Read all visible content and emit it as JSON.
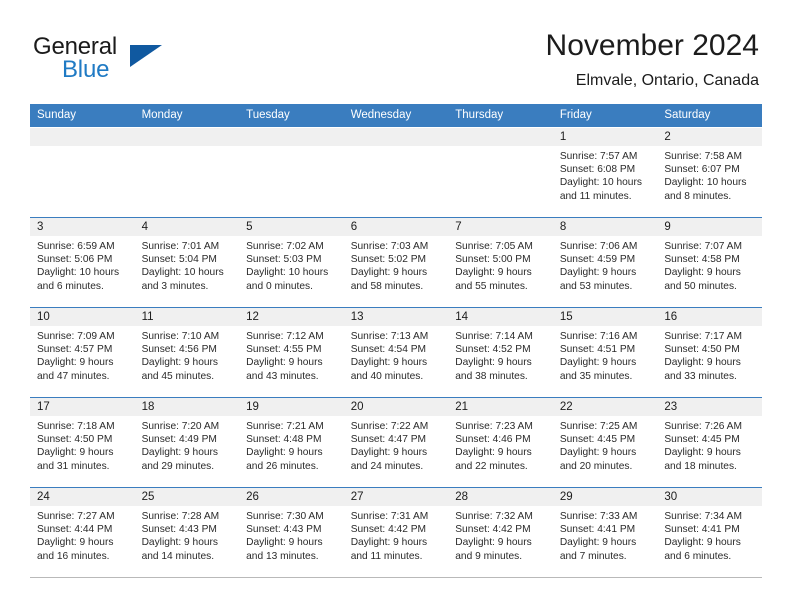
{
  "brand": {
    "name_part1": "General",
    "name_part2": "Blue",
    "triangle_color": "#1059a0",
    "blue_color": "#1f7ac4"
  },
  "header": {
    "title": "November 2024",
    "subtitle": "Elmvale, Ontario, Canada"
  },
  "theme": {
    "header_row_bg": "#3a7dbf",
    "daynum_band_bg": "#f0f0f0",
    "cell_bg": "#ffffff",
    "row_border": "#3a7dbf"
  },
  "weekday_headers": [
    "Sunday",
    "Monday",
    "Tuesday",
    "Wednesday",
    "Thursday",
    "Friday",
    "Saturday"
  ],
  "weeks": [
    [
      {
        "day": "",
        "sunrise": "",
        "sunset": "",
        "daylight_line1": "",
        "daylight_line2": ""
      },
      {
        "day": "",
        "sunrise": "",
        "sunset": "",
        "daylight_line1": "",
        "daylight_line2": ""
      },
      {
        "day": "",
        "sunrise": "",
        "sunset": "",
        "daylight_line1": "",
        "daylight_line2": ""
      },
      {
        "day": "",
        "sunrise": "",
        "sunset": "",
        "daylight_line1": "",
        "daylight_line2": ""
      },
      {
        "day": "",
        "sunrise": "",
        "sunset": "",
        "daylight_line1": "",
        "daylight_line2": ""
      },
      {
        "day": "1",
        "sunrise": "Sunrise: 7:57 AM",
        "sunset": "Sunset: 6:08 PM",
        "daylight_line1": "Daylight: 10 hours",
        "daylight_line2": "and 11 minutes."
      },
      {
        "day": "2",
        "sunrise": "Sunrise: 7:58 AM",
        "sunset": "Sunset: 6:07 PM",
        "daylight_line1": "Daylight: 10 hours",
        "daylight_line2": "and 8 minutes."
      }
    ],
    [
      {
        "day": "3",
        "sunrise": "Sunrise: 6:59 AM",
        "sunset": "Sunset: 5:06 PM",
        "daylight_line1": "Daylight: 10 hours",
        "daylight_line2": "and 6 minutes."
      },
      {
        "day": "4",
        "sunrise": "Sunrise: 7:01 AM",
        "sunset": "Sunset: 5:04 PM",
        "daylight_line1": "Daylight: 10 hours",
        "daylight_line2": "and 3 minutes."
      },
      {
        "day": "5",
        "sunrise": "Sunrise: 7:02 AM",
        "sunset": "Sunset: 5:03 PM",
        "daylight_line1": "Daylight: 10 hours",
        "daylight_line2": "and 0 minutes."
      },
      {
        "day": "6",
        "sunrise": "Sunrise: 7:03 AM",
        "sunset": "Sunset: 5:02 PM",
        "daylight_line1": "Daylight: 9 hours",
        "daylight_line2": "and 58 minutes."
      },
      {
        "day": "7",
        "sunrise": "Sunrise: 7:05 AM",
        "sunset": "Sunset: 5:00 PM",
        "daylight_line1": "Daylight: 9 hours",
        "daylight_line2": "and 55 minutes."
      },
      {
        "day": "8",
        "sunrise": "Sunrise: 7:06 AM",
        "sunset": "Sunset: 4:59 PM",
        "daylight_line1": "Daylight: 9 hours",
        "daylight_line2": "and 53 minutes."
      },
      {
        "day": "9",
        "sunrise": "Sunrise: 7:07 AM",
        "sunset": "Sunset: 4:58 PM",
        "daylight_line1": "Daylight: 9 hours",
        "daylight_line2": "and 50 minutes."
      }
    ],
    [
      {
        "day": "10",
        "sunrise": "Sunrise: 7:09 AM",
        "sunset": "Sunset: 4:57 PM",
        "daylight_line1": "Daylight: 9 hours",
        "daylight_line2": "and 47 minutes."
      },
      {
        "day": "11",
        "sunrise": "Sunrise: 7:10 AM",
        "sunset": "Sunset: 4:56 PM",
        "daylight_line1": "Daylight: 9 hours",
        "daylight_line2": "and 45 minutes."
      },
      {
        "day": "12",
        "sunrise": "Sunrise: 7:12 AM",
        "sunset": "Sunset: 4:55 PM",
        "daylight_line1": "Daylight: 9 hours",
        "daylight_line2": "and 43 minutes."
      },
      {
        "day": "13",
        "sunrise": "Sunrise: 7:13 AM",
        "sunset": "Sunset: 4:54 PM",
        "daylight_line1": "Daylight: 9 hours",
        "daylight_line2": "and 40 minutes."
      },
      {
        "day": "14",
        "sunrise": "Sunrise: 7:14 AM",
        "sunset": "Sunset: 4:52 PM",
        "daylight_line1": "Daylight: 9 hours",
        "daylight_line2": "and 38 minutes."
      },
      {
        "day": "15",
        "sunrise": "Sunrise: 7:16 AM",
        "sunset": "Sunset: 4:51 PM",
        "daylight_line1": "Daylight: 9 hours",
        "daylight_line2": "and 35 minutes."
      },
      {
        "day": "16",
        "sunrise": "Sunrise: 7:17 AM",
        "sunset": "Sunset: 4:50 PM",
        "daylight_line1": "Daylight: 9 hours",
        "daylight_line2": "and 33 minutes."
      }
    ],
    [
      {
        "day": "17",
        "sunrise": "Sunrise: 7:18 AM",
        "sunset": "Sunset: 4:50 PM",
        "daylight_line1": "Daylight: 9 hours",
        "daylight_line2": "and 31 minutes."
      },
      {
        "day": "18",
        "sunrise": "Sunrise: 7:20 AM",
        "sunset": "Sunset: 4:49 PM",
        "daylight_line1": "Daylight: 9 hours",
        "daylight_line2": "and 29 minutes."
      },
      {
        "day": "19",
        "sunrise": "Sunrise: 7:21 AM",
        "sunset": "Sunset: 4:48 PM",
        "daylight_line1": "Daylight: 9 hours",
        "daylight_line2": "and 26 minutes."
      },
      {
        "day": "20",
        "sunrise": "Sunrise: 7:22 AM",
        "sunset": "Sunset: 4:47 PM",
        "daylight_line1": "Daylight: 9 hours",
        "daylight_line2": "and 24 minutes."
      },
      {
        "day": "21",
        "sunrise": "Sunrise: 7:23 AM",
        "sunset": "Sunset: 4:46 PM",
        "daylight_line1": "Daylight: 9 hours",
        "daylight_line2": "and 22 minutes."
      },
      {
        "day": "22",
        "sunrise": "Sunrise: 7:25 AM",
        "sunset": "Sunset: 4:45 PM",
        "daylight_line1": "Daylight: 9 hours",
        "daylight_line2": "and 20 minutes."
      },
      {
        "day": "23",
        "sunrise": "Sunrise: 7:26 AM",
        "sunset": "Sunset: 4:45 PM",
        "daylight_line1": "Daylight: 9 hours",
        "daylight_line2": "and 18 minutes."
      }
    ],
    [
      {
        "day": "24",
        "sunrise": "Sunrise: 7:27 AM",
        "sunset": "Sunset: 4:44 PM",
        "daylight_line1": "Daylight: 9 hours",
        "daylight_line2": "and 16 minutes."
      },
      {
        "day": "25",
        "sunrise": "Sunrise: 7:28 AM",
        "sunset": "Sunset: 4:43 PM",
        "daylight_line1": "Daylight: 9 hours",
        "daylight_line2": "and 14 minutes."
      },
      {
        "day": "26",
        "sunrise": "Sunrise: 7:30 AM",
        "sunset": "Sunset: 4:43 PM",
        "daylight_line1": "Daylight: 9 hours",
        "daylight_line2": "and 13 minutes."
      },
      {
        "day": "27",
        "sunrise": "Sunrise: 7:31 AM",
        "sunset": "Sunset: 4:42 PM",
        "daylight_line1": "Daylight: 9 hours",
        "daylight_line2": "and 11 minutes."
      },
      {
        "day": "28",
        "sunrise": "Sunrise: 7:32 AM",
        "sunset": "Sunset: 4:42 PM",
        "daylight_line1": "Daylight: 9 hours",
        "daylight_line2": "and 9 minutes."
      },
      {
        "day": "29",
        "sunrise": "Sunrise: 7:33 AM",
        "sunset": "Sunset: 4:41 PM",
        "daylight_line1": "Daylight: 9 hours",
        "daylight_line2": "and 7 minutes."
      },
      {
        "day": "30",
        "sunrise": "Sunrise: 7:34 AM",
        "sunset": "Sunset: 4:41 PM",
        "daylight_line1": "Daylight: 9 hours",
        "daylight_line2": "and 6 minutes."
      }
    ]
  ]
}
